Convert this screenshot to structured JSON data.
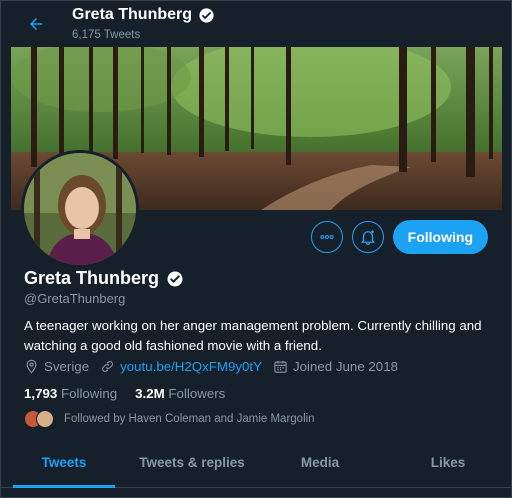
{
  "header": {
    "name": "Greta Thunberg",
    "tweet_count": "6,175 Tweets"
  },
  "profile": {
    "name": "Greta Thunberg",
    "handle": "@GretaThunberg",
    "bio": "A teenager working on her anger management problem. Currently chilling and watching a good old fashioned movie with a friend.",
    "location": "Sverige",
    "website": "youtu.be/H2QxFM9y0tY",
    "joined": "Joined June 2018",
    "following_count": "1,793",
    "following_label": "Following",
    "followers_count": "3.2M",
    "followers_label": "Followers",
    "followed_by": "Followed by Haven Coleman and Jamie Margolin"
  },
  "actions": {
    "follow_label": "Following"
  },
  "tabs": [
    {
      "label": "Tweets",
      "active": true
    },
    {
      "label": "Tweets & replies",
      "active": false
    },
    {
      "label": "Media",
      "active": false
    },
    {
      "label": "Likes",
      "active": false
    }
  ],
  "colors": {
    "background": "#15202b",
    "accent": "#1da1f2",
    "muted": "#8899a6"
  },
  "icons": [
    "back-arrow-icon",
    "verified-badge-icon",
    "more-icon",
    "notification-bell-icon",
    "location-icon",
    "link-icon",
    "calendar-icon"
  ]
}
